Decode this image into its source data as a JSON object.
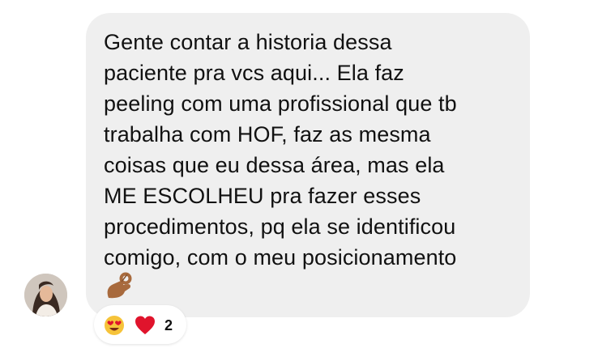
{
  "message": {
    "lines": [
      "Gente contar a historia dessa",
      "paciente pra vcs aqui... Ela faz",
      "peeling com uma profissional que tb",
      "trabalha com HOF, faz as mesma",
      "coisas que eu dessa área, mas ela",
      "ME ESCOLHEU pra fazer esses",
      "procedimentos, pq ela se identificou",
      "comigo, com o meu posicionamento"
    ],
    "trailing_emoji": "ok-hand-emoji"
  },
  "sender": {
    "avatar": "profile-photo"
  },
  "reactions": {
    "emojis": [
      "heart-eyes-emoji",
      "red-heart-emoji"
    ],
    "count": "2"
  },
  "colors": {
    "bubble": "#efefef",
    "text": "#111111",
    "heart": "#e0142c",
    "emoji_face": "#f6c33a"
  }
}
